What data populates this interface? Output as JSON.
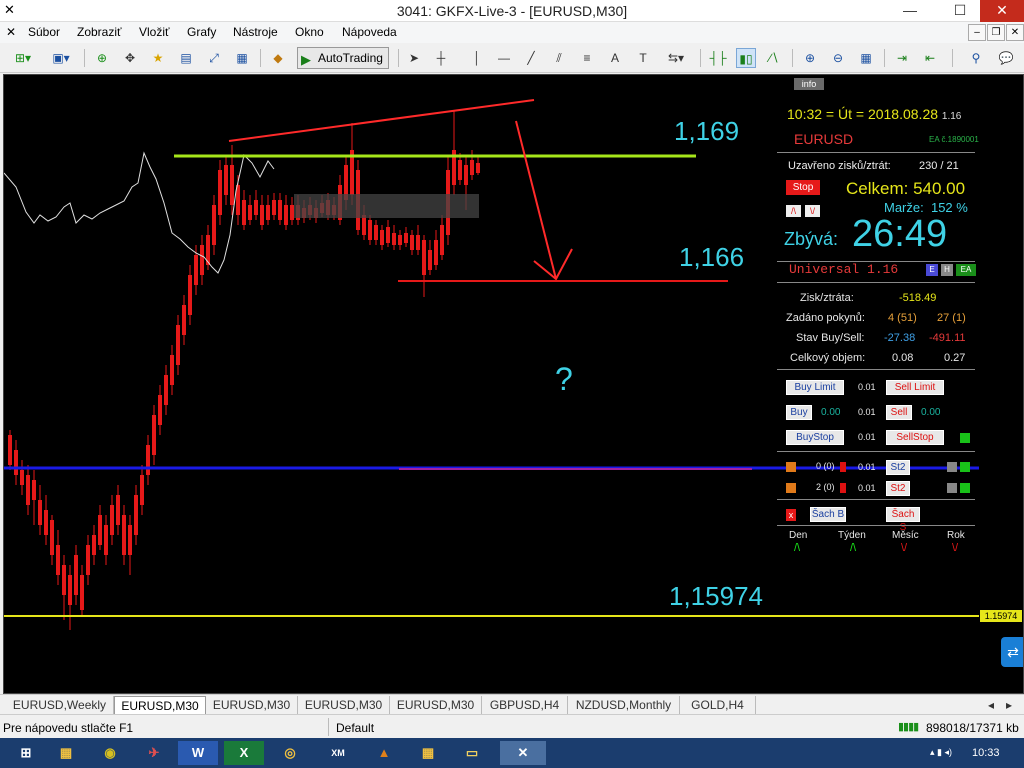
{
  "window": {
    "title": "3041: GKFX-Live-3 - [EURUSD,M30]",
    "title_display": "3041",
    "title_rest": ": GKFX-Live-3 - [EURUSD,M30]"
  },
  "menu": [
    "Súbor",
    "Zobraziť",
    "Vložiť",
    "Grafy",
    "Nástroje",
    "Okno",
    "Nápoveda"
  ],
  "toolbar": {
    "autotrading_label": "AutoTrading"
  },
  "chart": {
    "symbol": "EURUSD",
    "timeframe": "M30",
    "info_label": "info",
    "price_labels": {
      "upper": "1,169",
      "lower": "1,166",
      "bottom": "1,15974",
      "axis_tag": "1.15974"
    },
    "question_mark": "?",
    "colors": {
      "background": "#000000",
      "bull": "#19e619",
      "bear": "#e61919",
      "resistance": "#a6e61a",
      "trend": "#ff2a2a",
      "ma": "#1a1ae6",
      "support": "#e6e61a"
    }
  },
  "panel": {
    "clock": "10:32 = Út = 2018.08.28",
    "clock_small": "1.16",
    "symbol": "EURUSD",
    "ea_id": "EA č.1890001",
    "closed_label": "Uzavřeno zisků/ztrát:",
    "closed_value": "230 / 21",
    "stop_label": "Stop",
    "total_label": "Celkem:",
    "total_value": "540.00",
    "margin_label": "Marže:",
    "margin_value": "152 %",
    "remaining_label": "Zbývá:",
    "remaining_value": "26:49",
    "universal_label": "Universal 1.16",
    "pl_label": "Zisk/ztráta:",
    "pl_value": "-518.49",
    "orders_label": "Zadáno pokynů:",
    "orders_buy": "4 (51)",
    "orders_sell": "27 (1)",
    "state_label": "Stav Buy/Sell:",
    "state_buy": "-27.38",
    "state_sell": "-491.11",
    "volume_label": "Celkový objem:",
    "volume_buy": "0.08",
    "volume_sell": "0.27",
    "buy_limit": "Buy Limit",
    "sell_limit": "Sell Limit",
    "lot1": "0.01",
    "buy": "Buy",
    "sell": "Sell",
    "buy_price": "0.00",
    "sell_price": "0.00",
    "lot2": "0.01",
    "buy_stop": "BuyStop",
    "sell_stop": "SellStop",
    "lot3": "0.01",
    "row1_count": "0 (0)",
    "row1_lot": "0.01",
    "row1_btn": "St2",
    "row2_count": "2 (0)",
    "row2_lot": "0.01",
    "row2_btn": "St2",
    "sach_b": "Šach B",
    "sach_s": "Šach S",
    "periods": [
      "Den",
      "Týden",
      "Měsíc",
      "Rok"
    ],
    "period_signs": [
      "/\\",
      "/\\",
      "\\/",
      "\\/"
    ],
    "e_btn": "E",
    "h_btn": "H",
    "ea_btn": "EA"
  },
  "tabs": [
    "EURUSD,Weekly",
    "EURUSD,M30",
    "EURUSD,M30",
    "EURUSD,M30",
    "EURUSD,M30",
    "GBPUSD,H4",
    "NZDUSD,Monthly",
    "GOLD,H4"
  ],
  "status": {
    "help": "Pre nápovedu stlačte F1",
    "profile": "Default",
    "traffic": "898018/17371 kb"
  },
  "taskbar": {
    "clock": "10:33",
    "xm_label": "XM"
  }
}
